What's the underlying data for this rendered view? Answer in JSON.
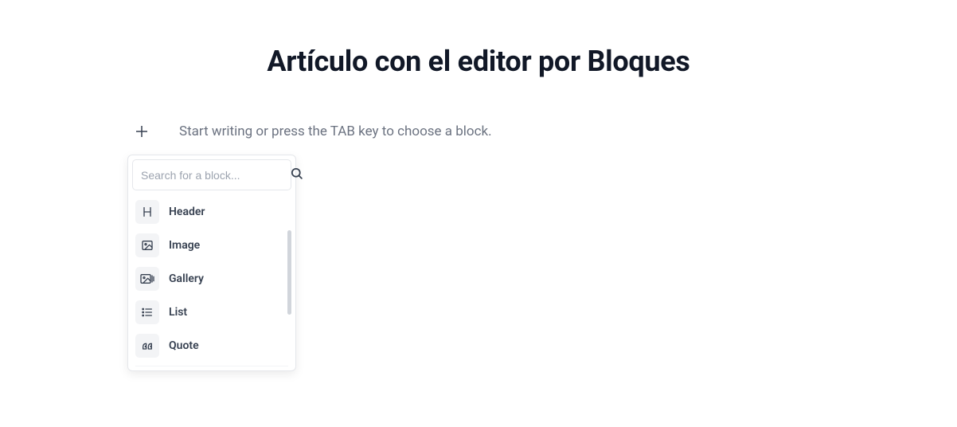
{
  "title": "Artículo con el editor por Bloques",
  "editor": {
    "placeholder_text": "Start writing or press the TAB key to choose a block."
  },
  "popover": {
    "search_placeholder": "Search for a block...",
    "items": [
      {
        "label": "Header"
      },
      {
        "label": "Image"
      },
      {
        "label": "Gallery"
      },
      {
        "label": "List"
      },
      {
        "label": "Quote"
      }
    ]
  }
}
